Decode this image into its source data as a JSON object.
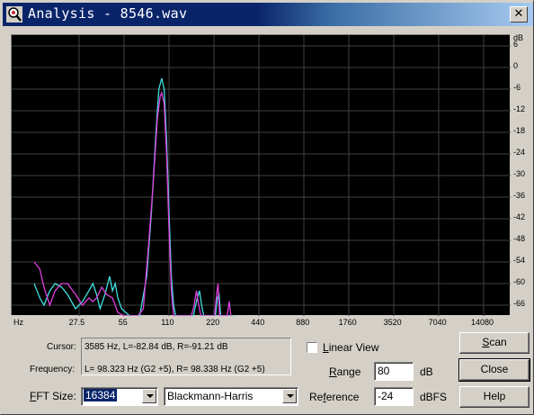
{
  "window": {
    "title": "Analysis - 8546.wav",
    "close_glyph": "✕",
    "icon": "search-icon"
  },
  "chart_data": {
    "type": "line",
    "x_scale": "log",
    "xlabel": "Hz",
    "ylabel": "dB",
    "x_ticks": [
      "27.5",
      "55",
      "110",
      "220",
      "440",
      "880",
      "1760",
      "3520",
      "7040",
      "14080"
    ],
    "y_ticks": [
      "6",
      "0",
      "-6",
      "-12",
      "-18",
      "-24",
      "-30",
      "-36",
      "-42",
      "-48",
      "-54",
      "-60",
      "-66"
    ],
    "ylim": [
      -69,
      9
    ],
    "grid": true,
    "colors": {
      "left": "#40e0e0",
      "right": "#e040e0"
    },
    "series": [
      {
        "values": [
          [
            13.75,
            -60
          ],
          [
            15,
            -64
          ],
          [
            16,
            -66
          ],
          [
            17.5,
            -62
          ],
          [
            19,
            -60
          ],
          [
            21,
            -61
          ],
          [
            23,
            -63
          ],
          [
            26,
            -67
          ],
          [
            29,
            -65
          ],
          [
            32,
            -62
          ],
          [
            34,
            -60
          ],
          [
            36,
            -63
          ],
          [
            38,
            -67
          ],
          [
            41,
            -63
          ],
          [
            44,
            -58
          ],
          [
            46,
            -62
          ],
          [
            48,
            -60
          ],
          [
            50,
            -64
          ],
          [
            53,
            -67
          ],
          [
            60,
            -69
          ],
          [
            70,
            -69
          ],
          [
            78,
            -58
          ],
          [
            84,
            -40
          ],
          [
            90,
            -18
          ],
          [
            94,
            -6
          ],
          [
            98.3,
            -3
          ],
          [
            102,
            -6
          ],
          [
            106,
            -20
          ],
          [
            110,
            -40
          ],
          [
            114,
            -58
          ],
          [
            118,
            -66
          ],
          [
            122,
            -69
          ],
          [
            160,
            -69
          ],
          [
            170,
            -64
          ],
          [
            176,
            -62
          ],
          [
            182,
            -66
          ],
          [
            188,
            -69
          ],
          [
            225,
            -69
          ],
          [
            232,
            -64
          ],
          [
            238,
            -63
          ],
          [
            244,
            -69
          ],
          [
            300,
            -69
          ]
        ]
      },
      {
        "values": [
          [
            13.75,
            -54
          ],
          [
            15,
            -56
          ],
          [
            16,
            -61
          ],
          [
            17.5,
            -66
          ],
          [
            19,
            -62
          ],
          [
            21,
            -60
          ],
          [
            23,
            -60
          ],
          [
            26,
            -63
          ],
          [
            29,
            -66
          ],
          [
            32,
            -64
          ],
          [
            34,
            -65
          ],
          [
            36,
            -64
          ],
          [
            39,
            -61
          ],
          [
            42,
            -63
          ],
          [
            46,
            -64
          ],
          [
            50,
            -68
          ],
          [
            55,
            -69
          ],
          [
            68,
            -69
          ],
          [
            74,
            -67
          ],
          [
            80,
            -50
          ],
          [
            86,
            -33
          ],
          [
            92,
            -14
          ],
          [
            96,
            -8
          ],
          [
            98.3,
            -7
          ],
          [
            102,
            -10
          ],
          [
            106,
            -24
          ],
          [
            110,
            -45
          ],
          [
            114,
            -62
          ],
          [
            118,
            -69
          ],
          [
            155,
            -69
          ],
          [
            162,
            -66
          ],
          [
            168,
            -62
          ],
          [
            174,
            -66
          ],
          [
            180,
            -69
          ],
          [
            222,
            -69
          ],
          [
            228,
            -64
          ],
          [
            234,
            -60
          ],
          [
            240,
            -69
          ],
          [
            270,
            -69
          ],
          [
            278,
            -65
          ],
          [
            286,
            -69
          ]
        ]
      }
    ]
  },
  "info": {
    "cursor_label": "Cursor:",
    "cursor_value": "3585 Hz, L=-82.84 dB, R=-91.21 dB",
    "frequency_label": "Frequency:",
    "frequency_value": "L= 98.323 Hz (G2 +5), R= 98.338 Hz (G2 +5)"
  },
  "fft": {
    "label_mnemonic": "F",
    "label_rest": "FT Size:",
    "size": "16384",
    "window": "Blackmann-Harris"
  },
  "linear_view": {
    "label_mnemonic": "L",
    "label_rest": "inear View",
    "checked": false
  },
  "range": {
    "label_mnemonic": "R",
    "label_rest": "ange",
    "value": "80",
    "unit": "dB"
  },
  "reference": {
    "label_pre": "Re",
    "label_mnemonic": "f",
    "label_rest": "erence",
    "value": "-24",
    "unit": "dBFS"
  },
  "buttons": {
    "scan_mnemonic": "S",
    "scan_rest": "can",
    "close": "Close",
    "help": "Help"
  }
}
